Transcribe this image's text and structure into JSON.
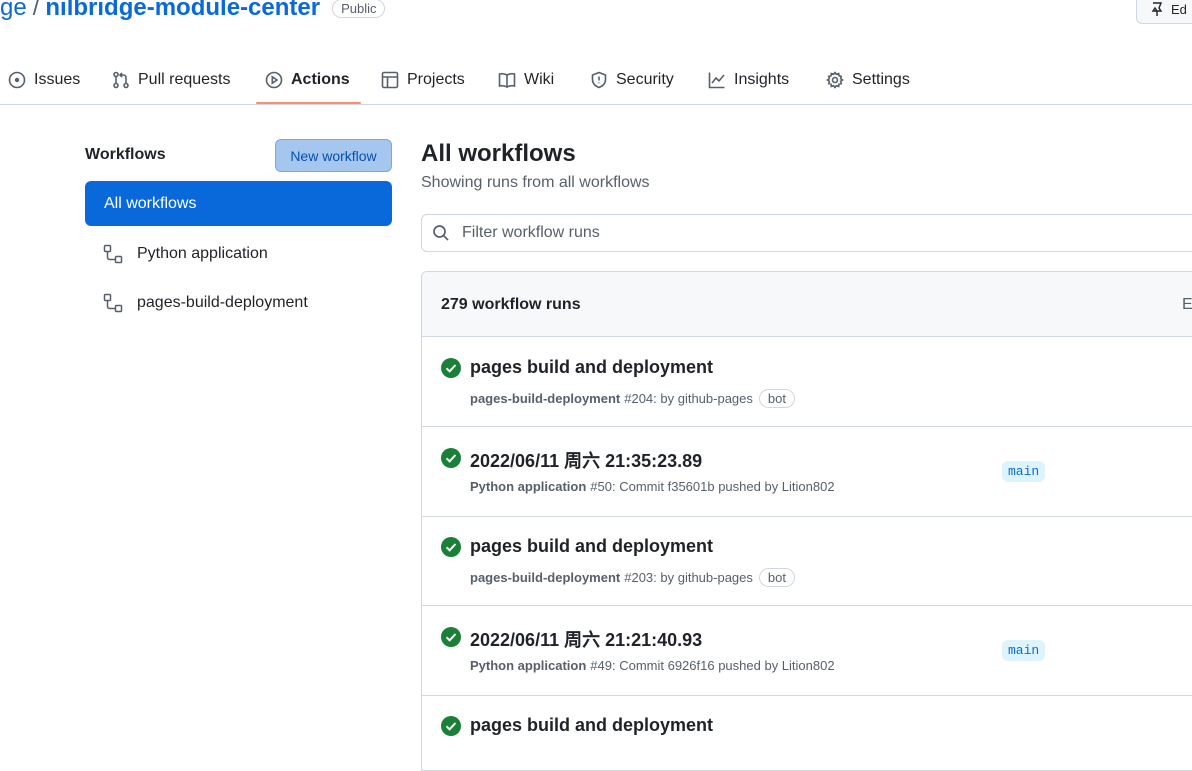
{
  "repo": {
    "owner_fragment": "ge",
    "separator": "/",
    "name": "nilbridge-module-center",
    "visibility": "Public"
  },
  "top_right_button": {
    "label": "Ed"
  },
  "nav": {
    "tabs": [
      {
        "label": "Issues",
        "icon": "issue-opened-icon"
      },
      {
        "label": "Pull requests",
        "icon": "git-pull-request-icon"
      },
      {
        "label": "Actions",
        "icon": "play-icon",
        "active": true
      },
      {
        "label": "Projects",
        "icon": "table-icon"
      },
      {
        "label": "Wiki",
        "icon": "book-icon"
      },
      {
        "label": "Security",
        "icon": "shield-icon"
      },
      {
        "label": "Insights",
        "icon": "graph-icon"
      },
      {
        "label": "Settings",
        "icon": "gear-icon"
      }
    ]
  },
  "sidebar": {
    "title": "Workflows",
    "new_workflow": "New workflow",
    "items": [
      {
        "label": "All workflows",
        "selected": true
      },
      {
        "label": "Python application",
        "icon": "workflow-icon"
      },
      {
        "label": "pages-build-deployment",
        "icon": "workflow-icon"
      }
    ]
  },
  "main": {
    "title": "All workflows",
    "subtitle": "Showing runs from all workflows",
    "filter_placeholder": "Filter workflow runs",
    "runs_count": "279 workflow runs",
    "runs_header_event": "E",
    "runs": [
      {
        "title": "pages build and deployment",
        "workflow": "pages-build-deployment",
        "detail": "#204: by github-pages",
        "badge": "bot",
        "status": "success"
      },
      {
        "title": "2022/06/11 周六 21:35:23.89",
        "workflow": "Python application",
        "detail": "#50: Commit f35601b pushed by Lition802",
        "branch": "main",
        "status": "success"
      },
      {
        "title": "pages build and deployment",
        "workflow": "pages-build-deployment",
        "detail": "#203: by github-pages",
        "badge": "bot",
        "status": "success"
      },
      {
        "title": "2022/06/11 周六 21:21:40.93",
        "workflow": "Python application",
        "detail": "#49: Commit 6926f16 pushed by Lition802",
        "branch": "main",
        "status": "success"
      },
      {
        "title": "pages build and deployment",
        "workflow": "",
        "detail": "",
        "badge": "",
        "status": "success"
      }
    ]
  },
  "colors": {
    "accent": "#0969da",
    "success": "#1a7f37",
    "tab_underline": "#fd8c73"
  }
}
